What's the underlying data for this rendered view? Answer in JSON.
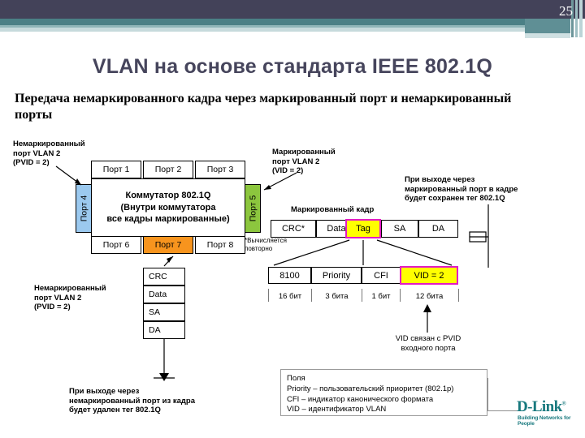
{
  "header": {
    "page_number": "25"
  },
  "title": "VLAN на основе стандарта IEEE 802.1Q",
  "subtitle": "Передача немаркированного кадра через маркированный порт и немаркированный порты",
  "annotations": {
    "untagged_port_top": "Немаркированный\nпорт VLAN 2\n(PVID = 2)",
    "tagged_port": "Маркированный\nпорт VLAN 2\n(VID = 2)",
    "tagged_exit_note": "При выходе через\nмаркированный порт в кадре\nбудет сохранен тег 802.1Q",
    "untagged_port_bottom": "Немаркированный\nпорт VLAN 2\n(PVID = 2)",
    "untagged_exit_note": "При выходе через\nнемаркированный порт из кадра\nбудет удален тег 802.1Q",
    "tagged_frame_label": "Маркированный кадр",
    "recalc_note": "*Вычисляется\nповторно",
    "vid_pvid_note": "VID связан с PVID\nвходного порта"
  },
  "switch": {
    "body_lines": "Коммутатор 802.1Q\n(Внутри коммутатора\nвсе кадры маркированные)",
    "top_ports": [
      "Порт 1",
      "Порт 2",
      "Порт 3"
    ],
    "bottom_ports": [
      "Порт 6",
      "Порт 7",
      "Порт 8"
    ],
    "left_port": "Порт 4",
    "right_port": "Порт 5",
    "colors": {
      "left_port": "#9bc9ef",
      "right_port": "#8cc63e",
      "highlight_port": "#f7941e"
    }
  },
  "tagged_frame": {
    "cells": [
      "CRC*",
      "Data",
      "Tag",
      "SA",
      "DA"
    ],
    "highlight_index": 2,
    "highlight_fill": "#ffff00",
    "highlight_border": "#e21bc4"
  },
  "tag_detail": {
    "cells": [
      "8100",
      "Priority",
      "CFI",
      "VID  = 2"
    ],
    "highlight_index": 3,
    "bit_labels": [
      "16 бит",
      "3 бита",
      "1 бит",
      "12 бита"
    ]
  },
  "untagged_frame_stack": [
    "CRC",
    "Data",
    "SA",
    "DA"
  ],
  "legend": {
    "text": "Поля\nPriority – пользовательский приоритет (802.1p)\nCFI – индикатор канонического формата\nVID – идентификатор VLAN"
  },
  "footer": {
    "brand": "D-Link",
    "tagline": "Building Networks for People",
    "brand_color": "#18797e"
  }
}
